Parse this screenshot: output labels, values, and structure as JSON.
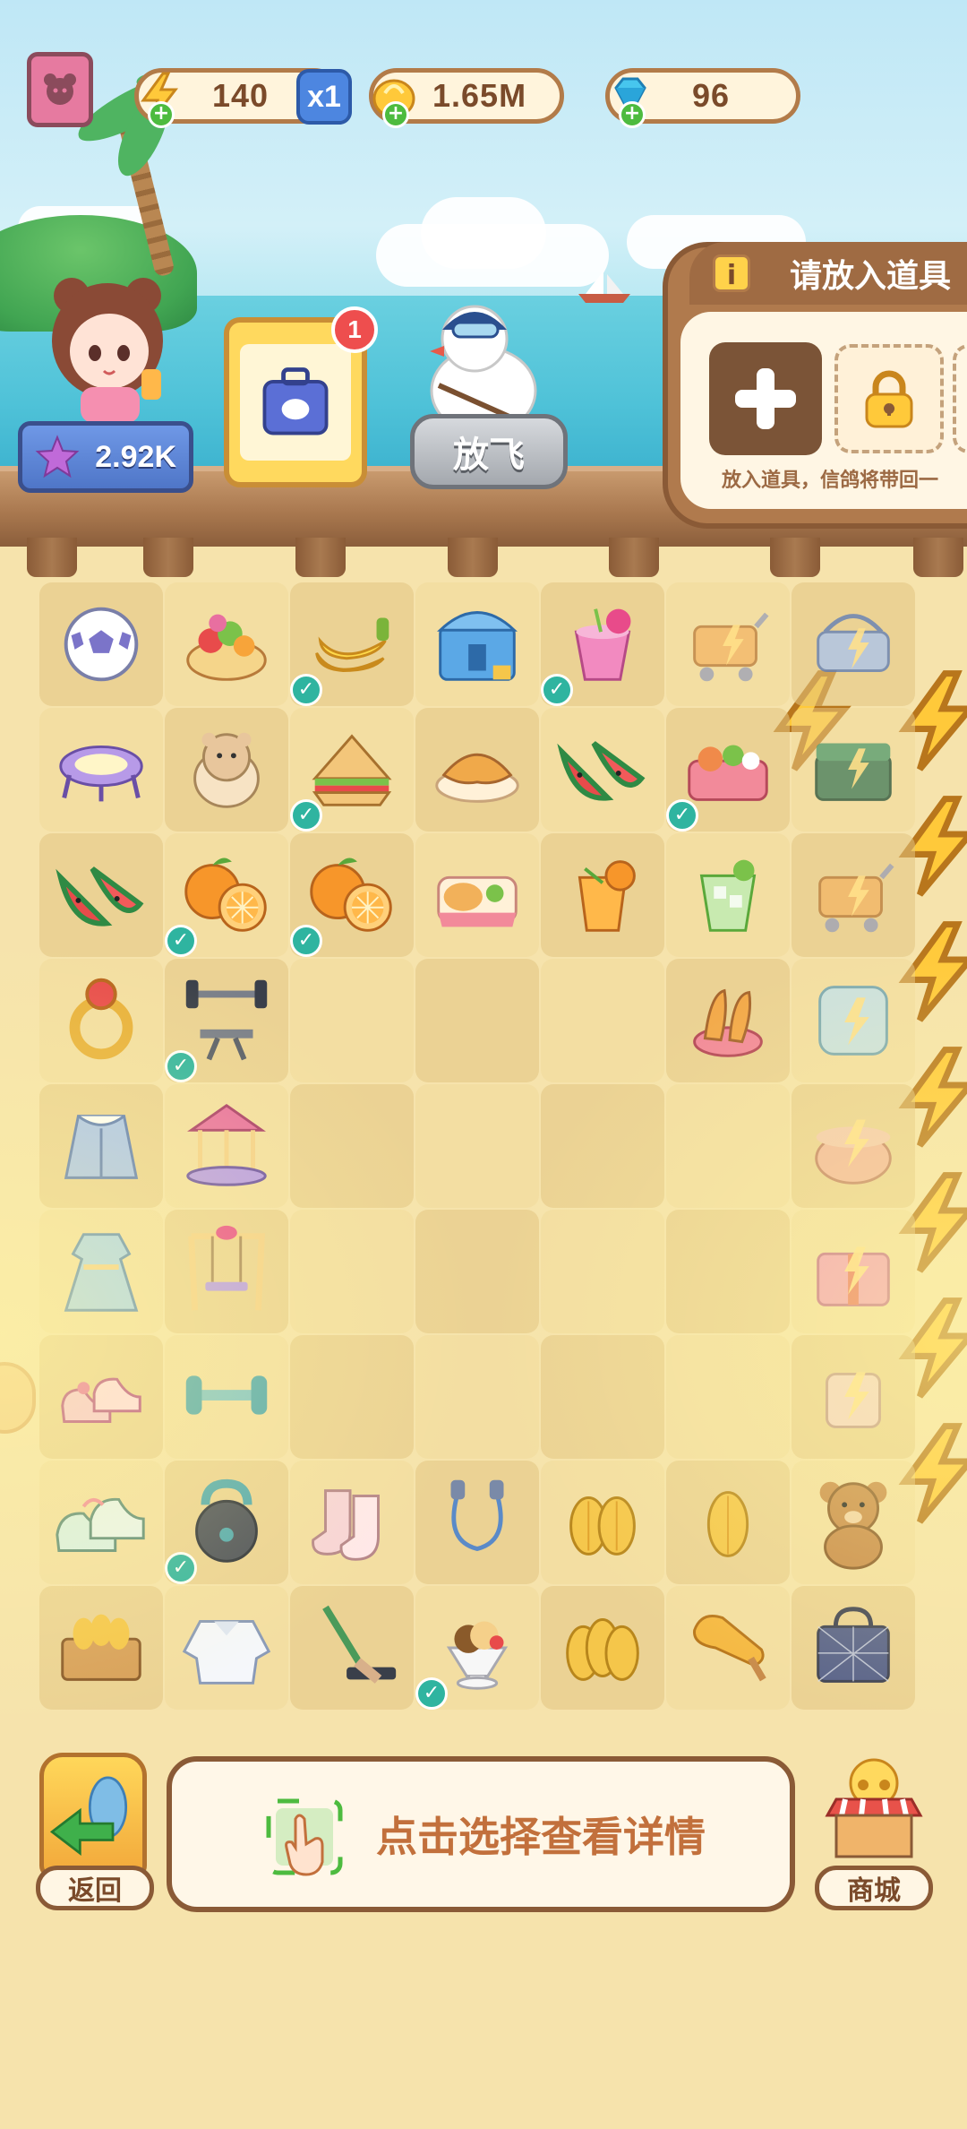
{
  "resources": {
    "energy": {
      "icon": "lightning-icon",
      "value": "140",
      "multiplier": "x1"
    },
    "coins": {
      "icon": "coin-icon",
      "value": "1.65M"
    },
    "gems": {
      "icon": "diamond-icon",
      "value": "96"
    }
  },
  "pier": {
    "girl_score": "2.92K",
    "notification_count": "1",
    "fly_button": "放飞"
  },
  "item_panel": {
    "title": "请放入道具",
    "hint": "放入道具，信鸽将带回一"
  },
  "board": {
    "rows": [
      [
        {
          "item": "soccer-ball-icon",
          "check": false,
          "bolt": false
        },
        {
          "item": "fruit-platter-icon",
          "check": false,
          "bolt": false
        },
        {
          "item": "banana-bunch-icon",
          "check": true,
          "bolt": false
        },
        {
          "item": "storage-chest-icon",
          "check": false,
          "bolt": false
        },
        {
          "item": "dragonfruit-drink-icon",
          "check": true,
          "bolt": false
        },
        {
          "item": "locked-cart-icon",
          "check": false,
          "bolt": true
        },
        {
          "item": "locked-basket-icon",
          "check": false,
          "bolt": true
        }
      ],
      [
        {
          "item": "trampoline-icon",
          "check": false,
          "bolt": false
        },
        {
          "item": "hamster-icon",
          "check": false,
          "bolt": false
        },
        {
          "item": "sandwich-icon",
          "check": true,
          "bolt": false
        },
        {
          "item": "croissant-plate-icon",
          "check": false,
          "bolt": false
        },
        {
          "item": "watermelon-icon",
          "check": false,
          "bolt": false
        },
        {
          "item": "bento-box-icon",
          "check": true,
          "bolt": false
        },
        {
          "item": "locked-chest-icon",
          "check": false,
          "bolt": true
        }
      ],
      [
        {
          "item": "watermelon-icon",
          "check": false,
          "bolt": false
        },
        {
          "item": "orange-icon",
          "check": true,
          "bolt": false
        },
        {
          "item": "orange-icon",
          "check": true,
          "bolt": false
        },
        {
          "item": "bread-box-icon",
          "check": false,
          "bolt": false
        },
        {
          "item": "orange-juice-icon",
          "check": false,
          "bolt": false
        },
        {
          "item": "lime-drink-icon",
          "check": false,
          "bolt": false
        },
        {
          "item": "locked-cart-icon",
          "check": false,
          "bolt": true
        }
      ],
      [
        {
          "item": "ruby-ring-icon",
          "check": false,
          "bolt": false
        },
        {
          "item": "weight-bench-icon",
          "check": true,
          "bolt": false
        },
        {
          "item": "",
          "check": false,
          "bolt": false
        },
        {
          "item": "",
          "check": false,
          "bolt": false
        },
        {
          "item": "",
          "check": false,
          "bolt": false
        },
        {
          "item": "fried-shrimp-icon",
          "check": false,
          "bolt": false
        },
        {
          "item": "locked-ice-box-icon",
          "check": false,
          "bolt": true
        }
      ],
      [
        {
          "item": "fur-coat-icon",
          "check": false,
          "bolt": false
        },
        {
          "item": "carousel-icon",
          "check": false,
          "bolt": false
        },
        {
          "item": "",
          "check": false,
          "bolt": false
        },
        {
          "item": "",
          "check": false,
          "bolt": false
        },
        {
          "item": "",
          "check": false,
          "bolt": false
        },
        {
          "item": "",
          "check": false,
          "bolt": false
        },
        {
          "item": "locked-pot-icon",
          "check": false,
          "bolt": true
        }
      ],
      [
        {
          "item": "blue-dress-icon",
          "check": false,
          "bolt": false
        },
        {
          "item": "swing-icon",
          "check": false,
          "bolt": false
        },
        {
          "item": "",
          "check": false,
          "bolt": false
        },
        {
          "item": "",
          "check": false,
          "bolt": false
        },
        {
          "item": "",
          "check": false,
          "bolt": false
        },
        {
          "item": "",
          "check": false,
          "bolt": false
        },
        {
          "item": "locked-gift-box-icon",
          "check": false,
          "bolt": true
        }
      ],
      [
        {
          "item": "pink-shoes-icon",
          "check": false,
          "bolt": false
        },
        {
          "item": "dumbbells-icon",
          "check": false,
          "bolt": false
        },
        {
          "item": "",
          "check": false,
          "bolt": false
        },
        {
          "item": "",
          "check": false,
          "bolt": false
        },
        {
          "item": "",
          "check": false,
          "bolt": false
        },
        {
          "item": "",
          "check": false,
          "bolt": false
        },
        {
          "item": "locked-stool-icon",
          "check": false,
          "bolt": true
        }
      ],
      [
        {
          "item": "sneakers-icon",
          "check": false,
          "bolt": false
        },
        {
          "item": "kettlebell-icon",
          "check": true,
          "bolt": false
        },
        {
          "item": "socks-icon",
          "check": false,
          "bolt": false
        },
        {
          "item": "jump-rope-icon",
          "check": false,
          "bolt": false
        },
        {
          "item": "seeds-pair-icon",
          "check": false,
          "bolt": false
        },
        {
          "item": "seed-icon",
          "check": false,
          "bolt": false
        },
        {
          "item": "teddy-bear-icon",
          "check": false,
          "bolt": false
        }
      ],
      [
        {
          "item": "seed-crate-icon",
          "check": false,
          "bolt": false
        },
        {
          "item": "white-shirt-icon",
          "check": false,
          "bolt": false
        },
        {
          "item": "squeegee-icon",
          "check": false,
          "bolt": false
        },
        {
          "item": "ice-cream-sundae-icon",
          "check": true,
          "bolt": false
        },
        {
          "item": "seed-pile-icon",
          "check": false,
          "bolt": false
        },
        {
          "item": "popsicle-icon",
          "check": false,
          "bolt": false
        },
        {
          "item": "cobweb-bag-icon",
          "check": false,
          "bolt": false
        }
      ]
    ]
  },
  "bottom": {
    "back_label": "返回",
    "hint_text": "点击选择查看详情",
    "shop_label": "商城"
  },
  "colors": {
    "board_bg": "#f6e3ac",
    "wood_border": "#8a5a36",
    "hint_text": "#c2703c",
    "check": "#2fb4a0"
  }
}
